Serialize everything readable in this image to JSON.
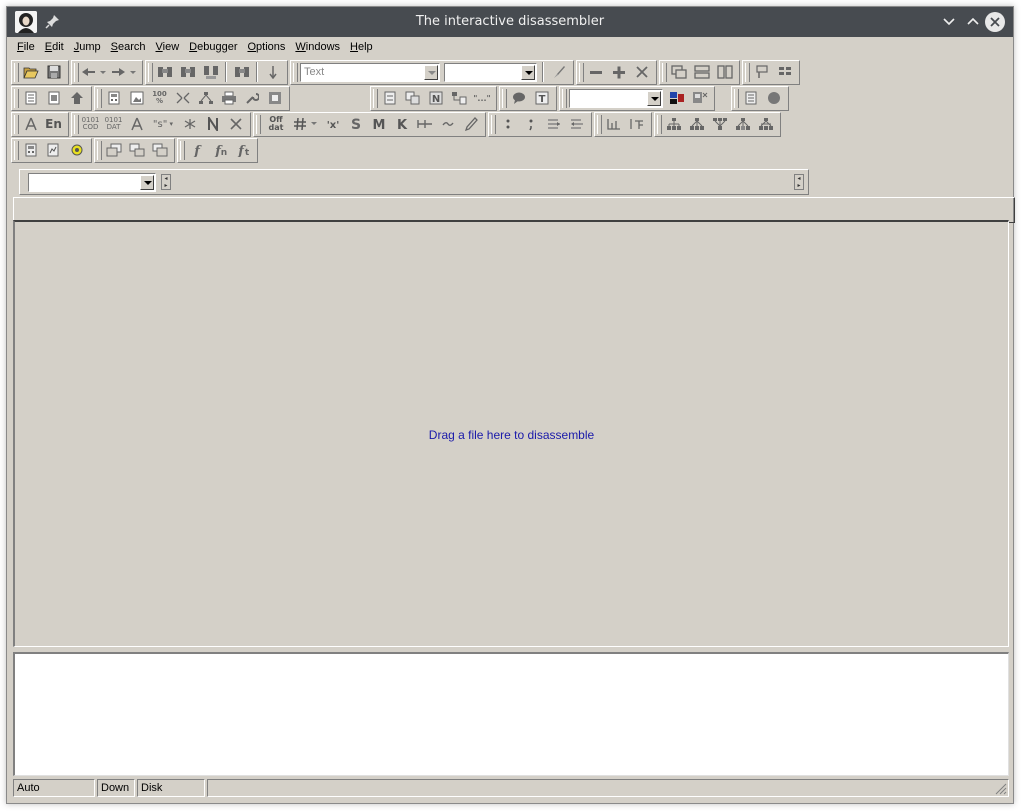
{
  "window": {
    "title": "The interactive disassembler"
  },
  "menu": {
    "items": [
      {
        "label": "File"
      },
      {
        "label": "Edit"
      },
      {
        "label": "Jump"
      },
      {
        "label": "Search"
      },
      {
        "label": "View"
      },
      {
        "label": "Debugger"
      },
      {
        "label": "Options"
      },
      {
        "label": "Windows"
      },
      {
        "label": "Help"
      }
    ]
  },
  "toolbar": {
    "segment_combo_value": "Text",
    "row3_en_label": "En",
    "row3_cod_label": "0101\nCOD",
    "row3_dat_label": "0101\nDAT",
    "row3_str_label": "\"s\"",
    "row3_off_label": "Off\ndat",
    "icon_color": "#555555"
  },
  "main": {
    "drop_hint": "Drag a file here to disassemble",
    "hint_color": "#1a1aaa"
  },
  "status": {
    "mode": "Auto",
    "direction": "Down",
    "state": "Disk"
  }
}
